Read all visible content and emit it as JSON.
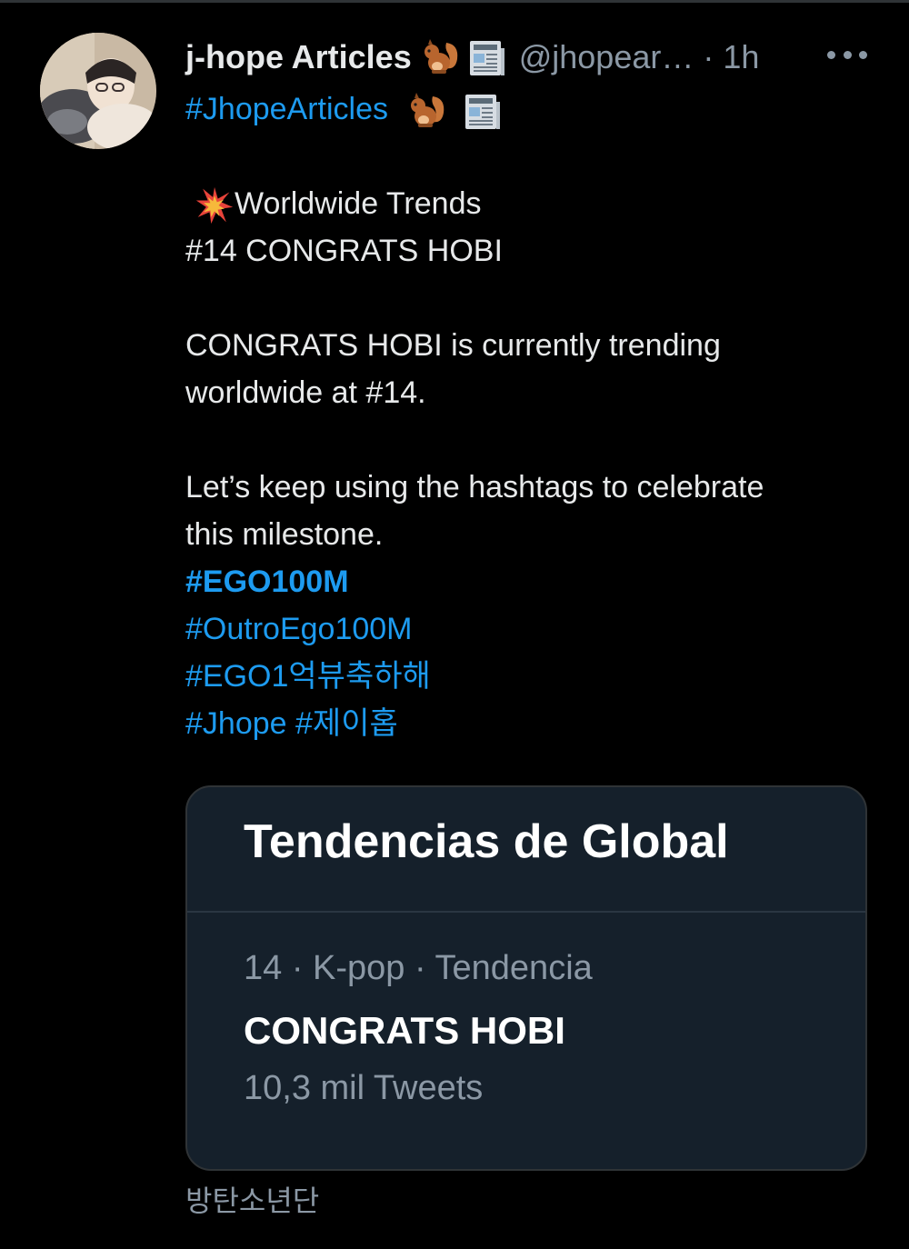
{
  "tweet": {
    "author": {
      "name": "j-hope Articles",
      "name_emojis": [
        "squirrel-icon",
        "newspaper-icon"
      ],
      "handle": "@jhopear…",
      "separator": "·",
      "time": "1h"
    },
    "body": {
      "hashtag_line": "#JhopeArticles",
      "trend_heading": "Worldwide Trends",
      "trend_rank_line": "#14 CONGRATS HOBI",
      "paragraph1_line1": "CONGRATS HOBI is currently trending",
      "paragraph1_line2": "worldwide at #14.",
      "paragraph2_line1": "Let’s keep using the hashtags to celebrate",
      "paragraph2_line2": "this milestone.",
      "hashtags": [
        "#EGO100M",
        "#OutroEgo100M",
        "#EGO1억뷰축하해"
      ],
      "hashtag_last_a": "#Jhope",
      "hashtag_last_b": "#제이홉"
    },
    "card": {
      "title": "Tendencias de Global",
      "meta": "14 · K-pop · Tendencia",
      "trend": "CONGRATS HOBI",
      "count": "10,3 mil Tweets"
    },
    "footer": "방탄소년단"
  },
  "colors": {
    "background": "#000000",
    "link": "#1d9bf0",
    "muted": "#8b98a5",
    "card_bg": "#15202b"
  }
}
